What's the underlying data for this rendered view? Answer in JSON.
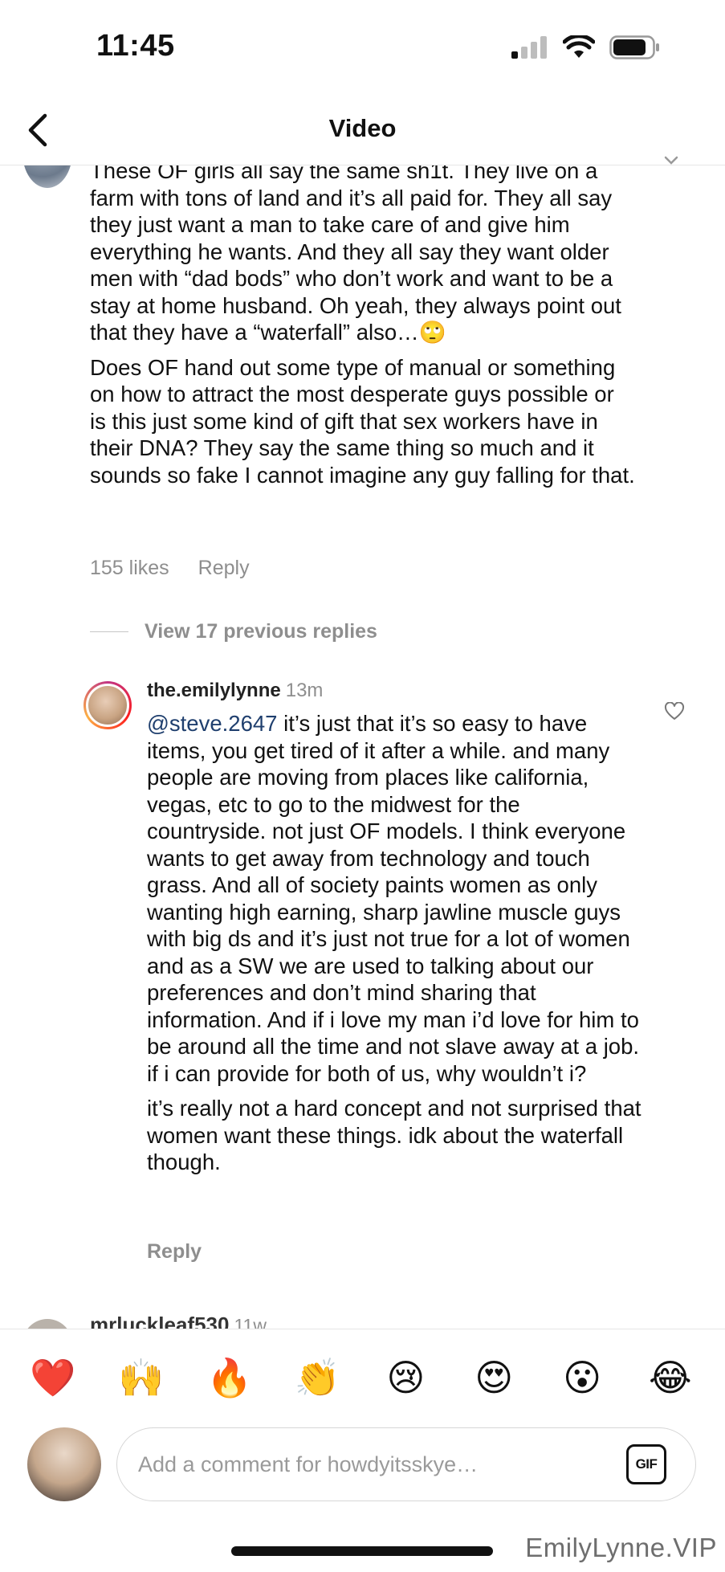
{
  "status_bar": {
    "time": "11:45"
  },
  "header": {
    "title": "Video"
  },
  "comment": {
    "paragraphs": [
      "These OF girls all say the same sh1t. They live on a farm with tons of land and it’s all paid for. They all say they just want a man to take care of and give him everything he wants. And they all say they want older men with “dad bods” who don’t work and want to be a stay at home husband. Oh yeah, they always point out that they have a “waterfall” also…🙄",
      "Does OF hand out some type of manual or something on how to attract the most desperate guys possible or is this just some kind of gift that sex workers have in their DNA? They say the same thing so much and it sounds so fake I cannot imagine any guy falling for that."
    ],
    "likes": "155 likes",
    "reply_label": "Reply"
  },
  "view_replies": "View 17 previous replies",
  "reply": {
    "username": "the.emilylynne",
    "time": "13m",
    "mention": "@steve.2647",
    "paragraph1_rest": " it’s just that it’s so easy to have items, you get tired of it after a while. and many people are moving from places like california, vegas, etc to go to the midwest for the countryside. not just OF models. I think everyone wants to get away from technology and touch grass. And all of society paints women as only wanting high earning, sharp jawline muscle guys with big ds and it’s just not true for a lot of women and as a SW we are used to talking about our preferences and don’t mind sharing that information. And if i love my man i’d love for him to be around all the time and not slave away at a job. if i can provide for both of us, why wouldn’t i?",
    "paragraph2": "it’s really not a hard concept and not surprised that women want these things. idk about the waterfall though.",
    "reply_label": "Reply"
  },
  "next_comment": {
    "username": "mrluckleaf530",
    "time": "11w"
  },
  "emoji_bar": [
    "❤️",
    "🙌",
    "🔥",
    "👏",
    "😢",
    "😍",
    "😮",
    "😂"
  ],
  "composer": {
    "placeholder": "Add a comment for howdyitsskye…",
    "gif_label": "GIF"
  },
  "watermark": "EmilyLynne.VIP"
}
